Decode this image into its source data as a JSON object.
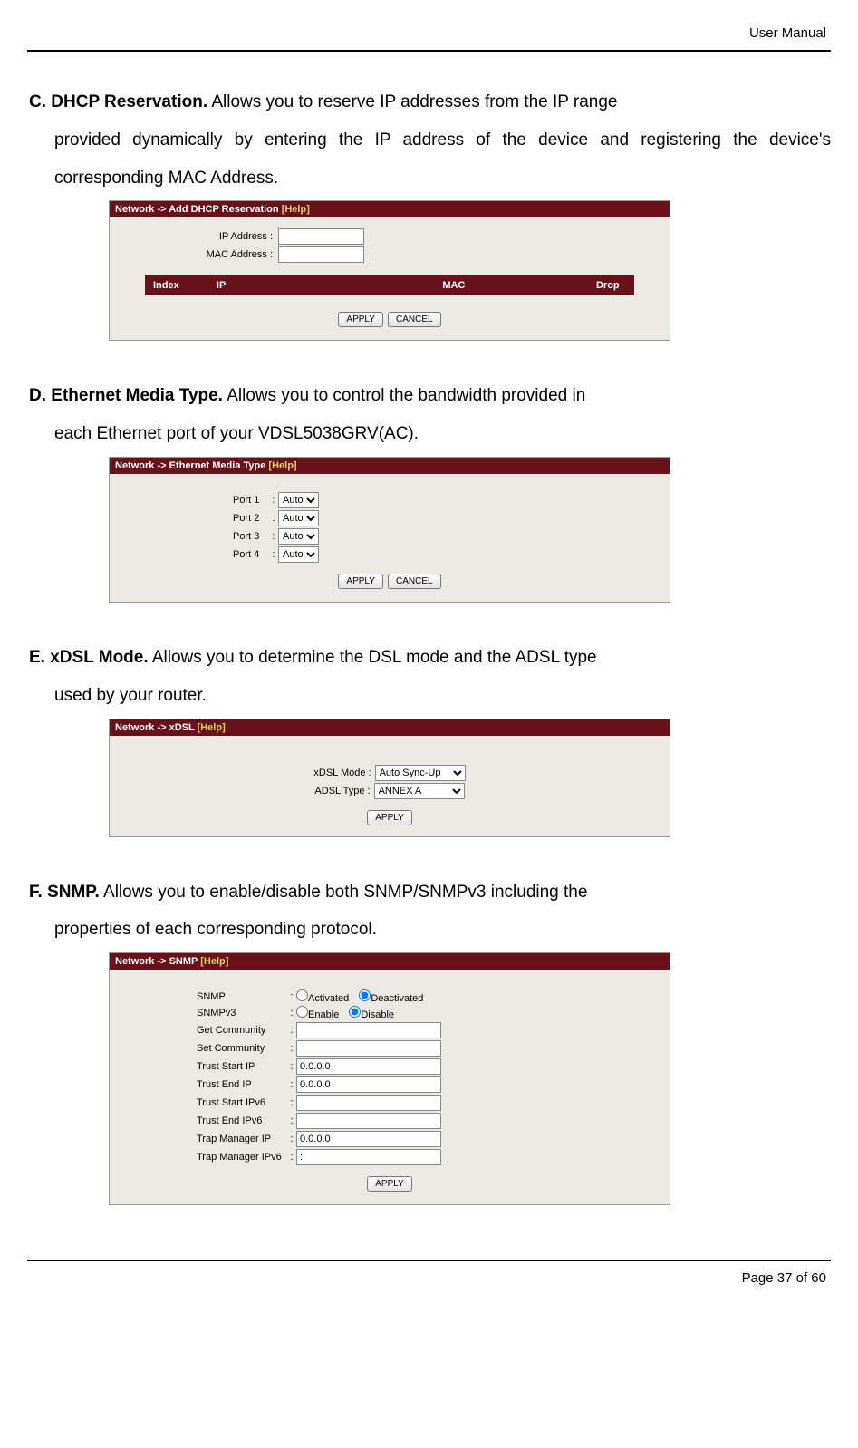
{
  "header": {
    "title": "User Manual"
  },
  "footer": {
    "page": "Page 37",
    "of": "of 60"
  },
  "buttons": {
    "apply": "APPLY",
    "cancel": "CANCEL"
  },
  "help_link": "[Help]",
  "sections": {
    "C": {
      "letter": "C.",
      "title": "DHCP Reservation.",
      "body_lead": " Allows you to reserve IP addresses from the IP range",
      "body_rest": "provided dynamically by entering the IP address of the device and registering the device's corresponding MAC Address.",
      "panel_title": "Network -> Add DHCP Reservation ",
      "fields": {
        "ip": "IP Address :",
        "mac": "MAC Address :"
      },
      "table": {
        "index": "Index",
        "ip": "IP",
        "mac": "MAC",
        "drop": "Drop"
      }
    },
    "D": {
      "letter": "D.",
      "title": "Ethernet Media Type.",
      "body_lead": " Allows you to control the bandwidth provided in",
      "body_rest": "each Ethernet port of your VDSL5038GRV(AC).",
      "panel_title": "Network -> Ethernet Media Type ",
      "ports": [
        "Port 1",
        "Port 2",
        "Port 3",
        "Port 4"
      ],
      "option": "Auto"
    },
    "E": {
      "letter": "E.",
      "title": "xDSL Mode.",
      "body_lead": " Allows you to determine the DSL mode and the ADSL type",
      "body_rest": "used by your router.",
      "panel_title": "Network -> xDSL ",
      "fields": {
        "xdsl_label": "xDSL Mode :",
        "xdsl_value": "Auto Sync-Up",
        "adsl_label": "ADSL Type :",
        "adsl_value": "ANNEX A"
      }
    },
    "F": {
      "letter": "F.",
      "title": "SNMP.",
      "body_lead": " Allows you to enable/disable both SNMP/SNMPv3 including the",
      "body_rest": "properties of each corresponding protocol.",
      "panel_title": "Network -> SNMP ",
      "labels": {
        "snmp": "SNMP",
        "snmpv3": "SNMPv3",
        "getc": "Get Community",
        "setc": "Set Community",
        "ts": "Trust Start IP",
        "te": "Trust End IP",
        "ts6": "Trust Start IPv6",
        "te6": "Trust End IPv6",
        "tm": "Trap Manager IP",
        "tm6": "Trap Manager IPv6"
      },
      "opts": {
        "activated": "Activated",
        "deactivated": "Deactivated",
        "enable": "Enable",
        "disable": "Disable"
      },
      "values": {
        "getc": "",
        "setc": "",
        "ts": "0.0.0.0",
        "te": "0.0.0.0",
        "ts6": "",
        "te6": "",
        "tm": "0.0.0.0",
        "tm6": "::"
      }
    }
  }
}
